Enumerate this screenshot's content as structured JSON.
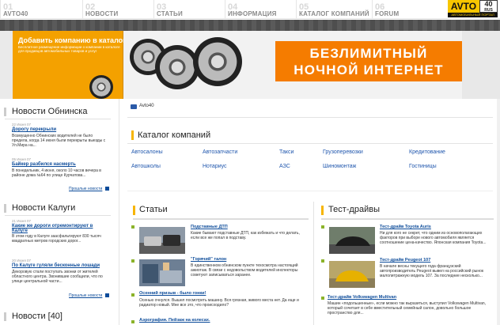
{
  "nav": {
    "items": [
      {
        "num": "01",
        "label": "AVTO40"
      },
      {
        "num": "02",
        "label": "НОВОСТИ"
      },
      {
        "num": "03",
        "label": "СТАТЬИ"
      },
      {
        "num": "04",
        "label": "ИНФОРМАЦИЯ"
      },
      {
        "num": "05",
        "label": "КАТАЛОГ КОМПАНИЙ"
      },
      {
        "num": "06",
        "label": "FORUM"
      }
    ],
    "logo_text": "AVTO",
    "logo_badge": "40",
    "logo_badge_sub": "RUS",
    "logo_sub": "АВТОМОБИЛЬНЫЙ ПОРТАЛ"
  },
  "banner": {
    "left_title": "Добавить компанию в каталог",
    "left_text": "Бесплатное размещение информации о компании в каталоге для продавцов автомобильных товаров и услуг",
    "ad_line1": "БЕЗЛИМИТНЫЙ",
    "ad_line2": "НОЧНОЙ ИНТЕРНЕТ"
  },
  "left": {
    "obninsk": {
      "title": "Новости Обнинска",
      "items": [
        {
          "date": "22 Июня 07",
          "title": "Дорогу перекрыли",
          "text": "Возмущенно Обнинских водителей не было предела, когда 14 июня были перекрыты выезды с Ул.Мира на..."
        },
        {
          "date": "05 Июня 07",
          "title": "Байкер разбился насмерть",
          "text": "В понедельник, 4 июня, около 10 часов вечера в районе дома №64 по улице Курчатова..."
        }
      ],
      "more": "Прошлые новости"
    },
    "kaluga": {
      "title": "Новости Калуги",
      "items": [
        {
          "date": "21 Июня 07",
          "title": "Какие же дороги отремонтируют в Калуге",
          "text": "В этом году в Калуге заасфальтируют 830 тысяч квадратных метров городских дорог..."
        },
        {
          "date": "20 Июня 07",
          "title": "По Калуге гуляли бесконные лошади",
          "text": "Декоровую стали поступать звонки от жителей областного центра. Звонившие сообщили, что по улице центральной части..."
        }
      ],
      "more": "Прошлые новости"
    },
    "avto40": {
      "title": "Новости [40]"
    }
  },
  "main": {
    "breadcrumb": "Avto40",
    "catalog": {
      "title": "Каталог компаний",
      "links": [
        [
          "Автосалоны",
          "Автозапчасти",
          "Такси",
          "Грузоперевозки",
          "Кредитование"
        ],
        [
          "Автошколы",
          "Нотариус",
          "АЗС",
          "Шиномонтаж",
          "Гостиницы"
        ]
      ]
    },
    "articles": {
      "title": "Статьи",
      "items": [
        {
          "title": "Подставные ДТП",
          "text": "Какие бывают подставные ДТП, как избежать и что делать, если все же попал в подставу."
        },
        {
          "title": "\"Горячий\" талон",
          "text": "В единственном обнинском пункте техосмотра настоящий ажиотаж. В связи с недовольством водителей инспекторы советуют записываться заранее."
        },
        {
          "title": "Осенний призыв - было гонки!",
          "text": "Осенью очнулся. Вышел посмотреть машину. Вся грязная, живого места нет. Да еще и радиатор новый. Мне все это, что происходило?"
        },
        {
          "title": "Аэрография. Пейзаж на колесах.",
          "text": ""
        }
      ]
    },
    "drives": {
      "title": "Тест-драйвы",
      "items": [
        {
          "title": "Тест-драйв Toyota Auris",
          "text": "Ни для кого не секрет, что одним из основополагающих факторов при выборе нового автомобиля является соотношение цена-качество. Японская компания Toyota..."
        },
        {
          "title": "Тест-драйв Peugeot 107",
          "text": "В начале весны текущего года французский автопроизводитель Peugeot вывел на российский рынок малолитражную модель 107. За последние несколько..."
        },
        {
          "title": "Тест-драйв Volkswagen Multivan",
          "text": "Машин «подольшенные», если можно так выразиться, выступил Volkswagen Multivan, который сочетает в себе вместительный семейный салон, довольно большое пространство для..."
        }
      ]
    }
  }
}
